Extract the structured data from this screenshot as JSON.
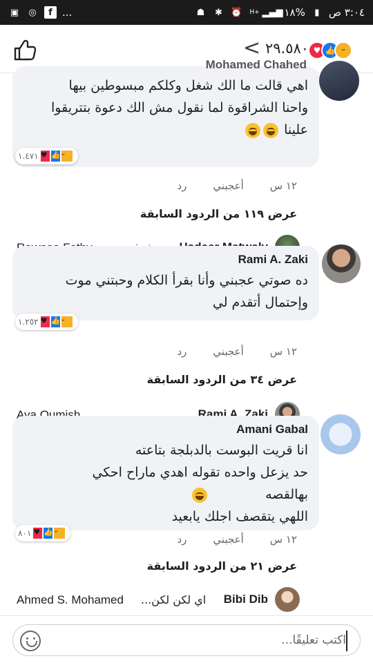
{
  "status_bar": {
    "time": "٣:٠٤ ص",
    "battery": "١٨%",
    "more": "...",
    "icons": [
      "gallery-icon",
      "whatsapp-icon",
      "facebook-icon",
      "android-icon",
      "bluetooth-icon",
      "alarm-icon",
      "hplus-signal-icon",
      "signal-bars-icon",
      "battery-icon"
    ]
  },
  "header": {
    "reaction_count": "٢٩.٥٨٠",
    "back_label": "<",
    "reactions": [
      "haha",
      "like",
      "love"
    ]
  },
  "comments": [
    {
      "name": "Mohamed Chahed",
      "text": "اهي قالت ما الك شغل وكلكم مبسوطين بيها\nواحنا الشراقوة لما نقول مش الك دعوة بتتريقوا\nعلينا",
      "time": "١٢ س",
      "like": "أعجبني",
      "reply": "رد",
      "reaction_count": "١.٤٧١",
      "view_more": "عرض ١١٩ من الردود السابقة",
      "preview": {
        "name": "Hadeer Metwaly",
        "text": "شوفت م...",
        "other": "Rawnaa Fathy"
      }
    },
    {
      "name": "Rami A. Zaki",
      "text": "ده صوتي عجبني وأنا بقرأ الكلام وحبتني موت\nوإحتمال أتقدم لي",
      "time": "١٢ س",
      "like": "أعجبني",
      "reply": "رد",
      "reaction_count": "١.٢٥٢",
      "view_more": "عرض ٣٤ من الردود السابقة",
      "preview": {
        "name": "Rami A. Zaki",
        "text": "",
        "other": "Aya Oumish ..."
      }
    },
    {
      "name": "Amani Gabal",
      "text": "انا قريت البوست بالدبلجة بتاعته\nحد يزعل واحده تقوله اهدي ماراح احكي\nبهالقصه\nاللهي يتقصف اجلك يابعيد",
      "time": "١٢ س",
      "like": "أعجبني",
      "reply": "رد",
      "reaction_count": "٨٠١",
      "view_more": "عرض ٢١ من الردود السابقة",
      "preview": {
        "name": "Bibi Dib",
        "text": "اي لكن لكن...",
        "other": "Ahmed S. Mohamed"
      }
    }
  ],
  "composer": {
    "placeholder": "اكتب تعليقًا..."
  }
}
